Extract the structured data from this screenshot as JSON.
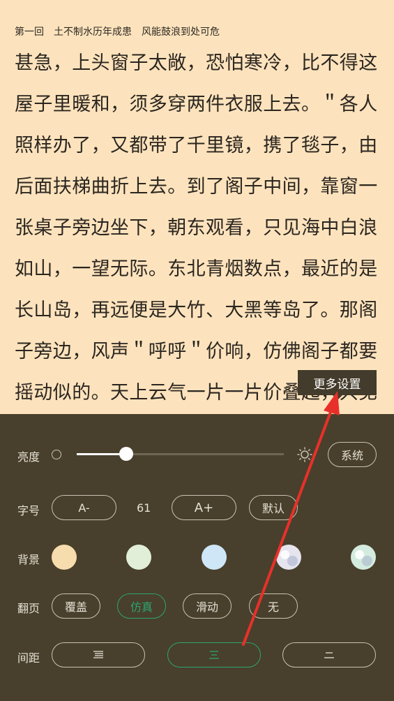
{
  "reader": {
    "chapter_title": "第一回　土不制水历年成患　风能鼓浪到处可危",
    "lines": [
      "甚急，上头窗子太敞，恐怕寒冷，比不得这",
      "屋子里暖和，须多穿两件衣服上去。＂各人",
      "照样办了，又都带了千里镜，携了毯子，由",
      "后面扶梯曲折上去。到了阁子中间，靠窗一",
      "张桌子旁边坐下，朝东观看，只见海中白浪",
      "如山，一望无际。东北青烟数点，最近的是",
      "长山岛，再远便是大竹、大黑等岛了。那阁",
      "子旁边，风声＂呼呼＂价响，仿佛阁子都要",
      "摇动似的。天上云气一片一片价叠起，只见"
    ]
  },
  "tooltip": {
    "label": "更多设置"
  },
  "settings": {
    "brightness": {
      "label": "亮度",
      "value": 0.24,
      "system_label": "系统"
    },
    "font_size": {
      "label": "字号",
      "decrease_label": "A-",
      "value": "61",
      "increase_label": "A+",
      "default_label": "默认"
    },
    "background": {
      "label": "背景",
      "swatches": [
        {
          "name": "beige",
          "color": "#f7dcad"
        },
        {
          "name": "light-green",
          "color": "#e1efd8"
        },
        {
          "name": "light-blue",
          "color": "#cfe6f7"
        },
        {
          "name": "white-pattern",
          "color": "#e5e4ef"
        },
        {
          "name": "mint-pattern",
          "color": "#d3ecdf"
        }
      ]
    },
    "page_turn": {
      "label": "翻页",
      "options": [
        {
          "label": "覆盖",
          "active": false
        },
        {
          "label": "仿真",
          "active": true
        },
        {
          "label": "滑动",
          "active": false
        },
        {
          "label": "无",
          "active": false
        }
      ]
    },
    "spacing": {
      "label": "间距",
      "active_index": 1
    }
  },
  "colors": {
    "accent": "#2da471",
    "panel_bg": "#48402c",
    "page_bg": "#fde3bd",
    "annotation_red": "#e8302a"
  }
}
